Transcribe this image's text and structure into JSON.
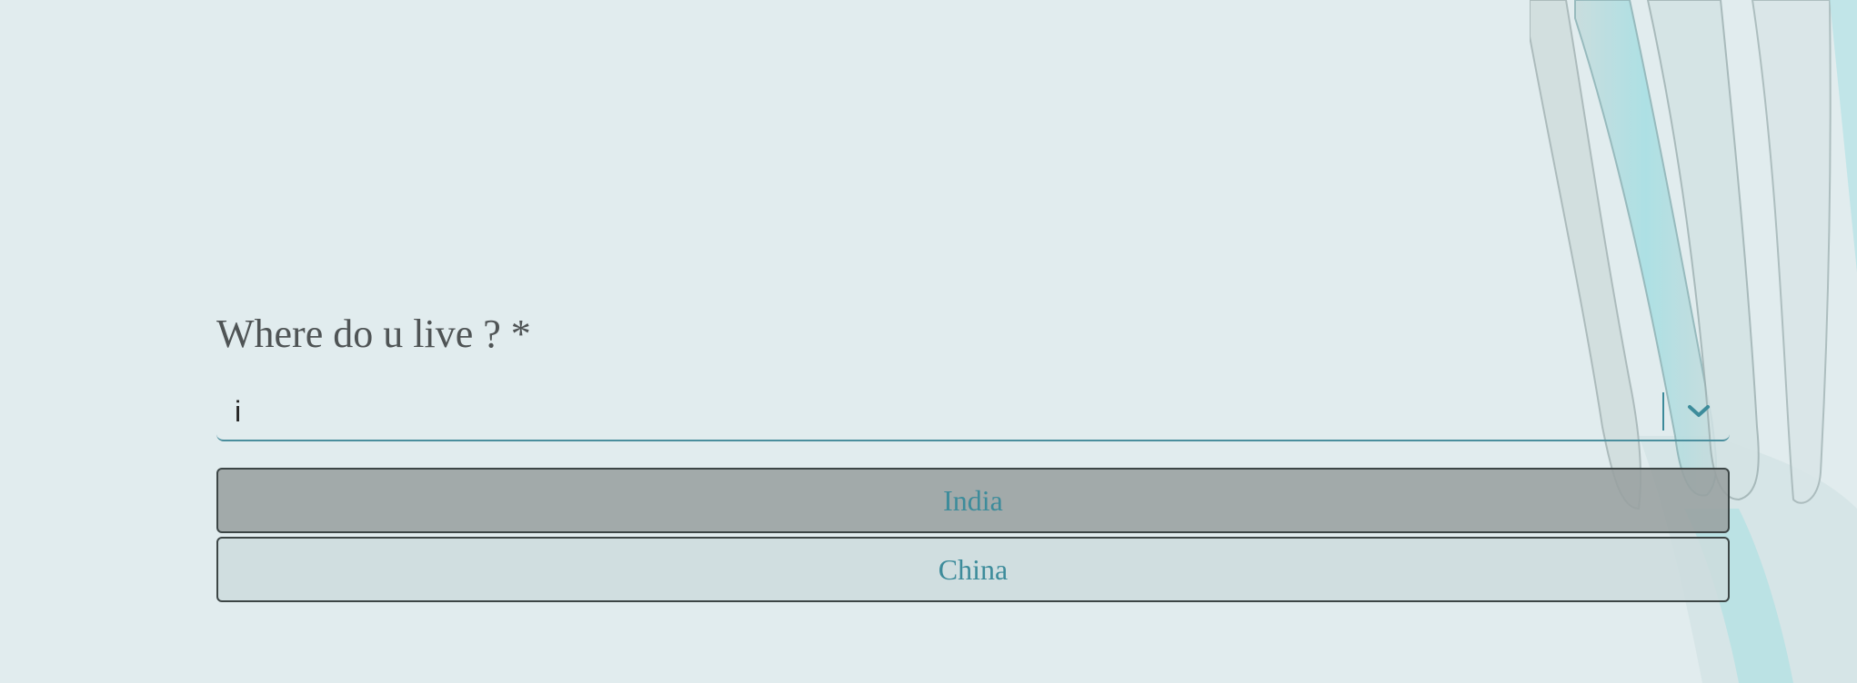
{
  "question": {
    "label": "Where do u live ? *"
  },
  "select": {
    "input_value": "i",
    "indicator_icon": "chevron-down-icon"
  },
  "options": [
    {
      "label": "India",
      "focused": true
    },
    {
      "label": "China",
      "focused": false
    }
  ],
  "colors": {
    "background": "#e1ecee",
    "accent": "#3d8c9b",
    "focused_option_bg": "#a2aaab",
    "option_bg": "#cfdddd"
  }
}
